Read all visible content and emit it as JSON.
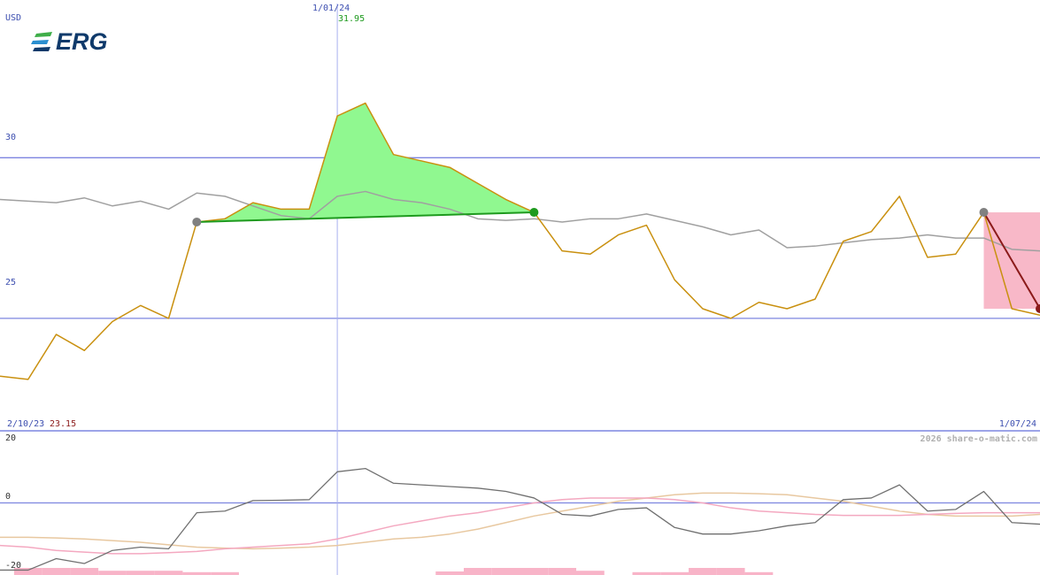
{
  "header": {
    "currency": "USD",
    "logo_text": "ERG",
    "cursor_date": "1/01/24",
    "cursor_value": "31.95",
    "start_date": "2/10/23",
    "start_value": "23.15",
    "end_date": "1/07/24",
    "watermark": "2026 share-o-matic.com"
  },
  "colors": {
    "price": "#c9900f",
    "moving_average": "#a0a0a0",
    "gain_fill": "#90f890",
    "gain_line": "#1e9a1e",
    "loss_fill": "#f8b8c8",
    "loss_line": "#8b1a1a",
    "grid": "#7d85e0",
    "cursor": "#a8b0f0",
    "oscillator": "#707070",
    "slow_pink": "#f4a8c0",
    "slow_tan": "#e8c8a0",
    "histogram": "#f8b4c8"
  },
  "chart_data": [
    {
      "type": "line",
      "panel": "price",
      "ylabel": "USD",
      "y_ticks": [
        "30",
        "25"
      ],
      "ylim": [
        21.5,
        34.8
      ],
      "x_range": [
        "2/10/23",
        "1/07/24"
      ],
      "series": [
        {
          "values": [
            23.2,
            23.1,
            24.5,
            24.0,
            24.9,
            25.4,
            25.0,
            28.0,
            28.1,
            28.6,
            28.4,
            28.4,
            31.3,
            31.7,
            30.1,
            29.9,
            29.7,
            29.2,
            28.7,
            28.3,
            27.1,
            27.0,
            27.6,
            27.9,
            26.2,
            25.3,
            25.0,
            25.5,
            25.3,
            25.6,
            27.4,
            27.7,
            28.8,
            26.9,
            27.0,
            28.3,
            25.3,
            25.1
          ]
        },
        {
          "values": [
            28.7,
            28.65,
            28.6,
            28.75,
            28.5,
            28.65,
            28.4,
            28.9,
            28.8,
            28.5,
            28.2,
            28.1,
            28.8,
            28.95,
            28.7,
            28.6,
            28.4,
            28.1,
            28.05,
            28.1,
            28.0,
            28.1,
            28.1,
            28.25,
            28.05,
            27.85,
            27.6,
            27.75,
            27.2,
            27.25,
            27.35,
            27.45,
            27.5,
            27.6,
            27.5,
            27.5,
            27.15,
            27.1
          ]
        }
      ],
      "gain_trade": {
        "entry": 28.0,
        "exit": 28.3,
        "entry_point": 7,
        "exit_point": 19
      },
      "loss_trade": {
        "entry": 28.3,
        "exit": 25.3,
        "entry_point": 35,
        "exit_point": 37
      },
      "cursor_point": 12
    },
    {
      "type": "line",
      "panel": "oscillator",
      "y_ticks": [
        "20",
        "0",
        "-20"
      ],
      "ylim": [
        -22,
        22
      ],
      "series": [
        {
          "values": [
            -20.5,
            -20.5,
            -17.0,
            -18.5,
            -14.5,
            -13.5,
            -14.0,
            -3.0,
            -2.5,
            0.7,
            0.8,
            1.0,
            9.5,
            10.5,
            6.0,
            5.5,
            5.0,
            4.5,
            3.5,
            1.5,
            -3.5,
            -4.0,
            -2.0,
            -1.5,
            -7.5,
            -9.5,
            -9.5,
            -8.5,
            -7.0,
            -6.0,
            1.0,
            1.5,
            5.5,
            -2.5,
            -2.0,
            3.5,
            -6.0,
            -6.5
          ]
        },
        {
          "values": [
            -13.0,
            -13.5,
            -14.5,
            -15.0,
            -15.5,
            -15.5,
            -15.2,
            -14.8,
            -14.0,
            -13.5,
            -13.0,
            -12.5,
            -11.0,
            -9.0,
            -7.0,
            -5.5,
            -4.0,
            -3.0,
            -1.5,
            0.0,
            1.0,
            1.5,
            1.5,
            1.5,
            1.0,
            0.0,
            -1.5,
            -2.5,
            -3.0,
            -3.5,
            -3.8,
            -3.8,
            -3.8,
            -3.5,
            -3.2,
            -3.0,
            -3.0,
            -3.0
          ]
        },
        {
          "values": [
            -10.5,
            -10.5,
            -10.7,
            -11.0,
            -11.5,
            -12.0,
            -12.8,
            -13.5,
            -13.8,
            -14.0,
            -13.8,
            -13.5,
            -13.0,
            -12.0,
            -11.0,
            -10.5,
            -9.5,
            -8.0,
            -6.0,
            -4.0,
            -2.5,
            -1.0,
            0.5,
            1.5,
            2.5,
            3.0,
            3.0,
            2.8,
            2.5,
            1.5,
            0.5,
            -1.0,
            -2.5,
            -3.5,
            -4.0,
            -4.0,
            -4.0,
            -3.5
          ]
        }
      ],
      "histogram": [
        0,
        1,
        1,
        1,
        0.6,
        0.6,
        0.6,
        0.4,
        0.4,
        0,
        0,
        0,
        0,
        0,
        0,
        0,
        0.5,
        1,
        1,
        1,
        1,
        0.6,
        0,
        0.4,
        0.4,
        1,
        1,
        0.4,
        0,
        0,
        0,
        0,
        0,
        0,
        0,
        0,
        0,
        0
      ]
    }
  ]
}
